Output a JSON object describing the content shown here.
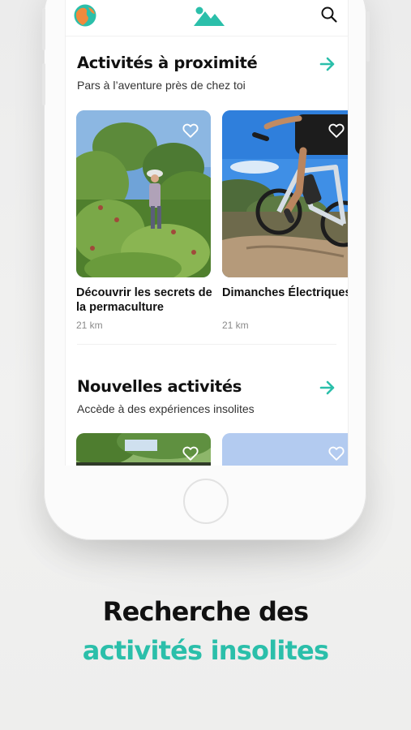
{
  "colors": {
    "accent": "#2bbfaa",
    "title_text": "#111111",
    "muted_text": "#8a8a8a",
    "tagline_dark": "#111111"
  },
  "header": {
    "avatar_icon": "globe-avatar-icon",
    "logo_icon": "mountain-logo-icon",
    "search_icon": "search-icon"
  },
  "sections": [
    {
      "title": "Activités à proximité",
      "subtitle": "Pars à l’aventure près de chez toi",
      "arrow_icon": "arrow-right-icon",
      "cards": [
        {
          "title": "Découvrir les secrets de la permaculture",
          "distance": "21 km",
          "image": "garden-photo",
          "favorite_icon": "heart-icon"
        },
        {
          "title": "Dimanches Électriques",
          "distance": "21 km",
          "image": "ebike-photo",
          "favorite_icon": "heart-icon"
        }
      ]
    },
    {
      "title": "Nouvelles activités",
      "subtitle": "Accède à des expériences insolites",
      "arrow_icon": "arrow-right-icon",
      "cards": [
        {
          "image": "trees-photo",
          "favorite_icon": "heart-icon"
        },
        {
          "image": "sky-photo",
          "favorite_icon": "heart-icon"
        }
      ]
    }
  ],
  "tagline": {
    "line1": "Recherche des",
    "line2": "activités insolites"
  }
}
